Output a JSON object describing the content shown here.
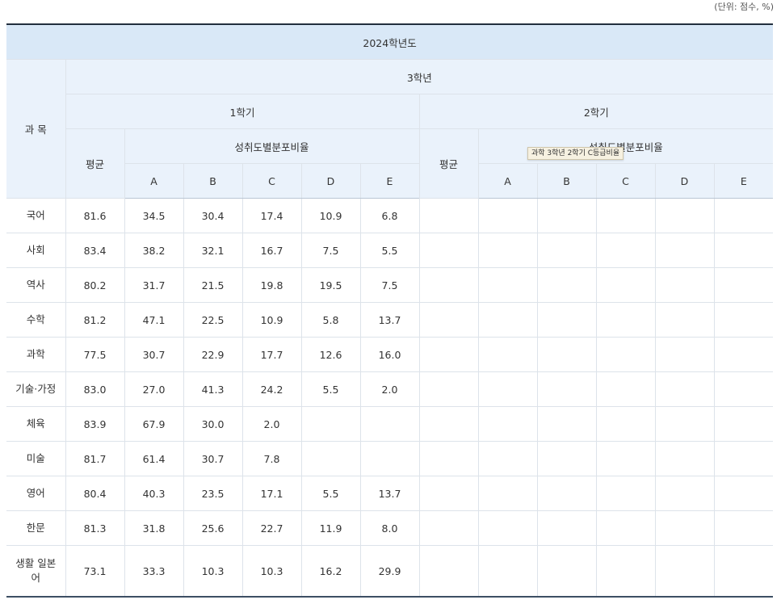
{
  "unit_note": "(단위: 점수, %)",
  "header": {
    "year": "2024학년도",
    "subject_col": "과 목",
    "grade": "3학년",
    "semester1": "1학기",
    "semester2": "2학기",
    "average": "평균",
    "distribution": "성취도별분포비율",
    "letters": [
      "A",
      "B",
      "C",
      "D",
      "E"
    ]
  },
  "tooltip": "과학 3학년 2학기 C등급비율",
  "rows": [
    {
      "subject": "국어",
      "s1": [
        "81.6",
        "34.5",
        "30.4",
        "17.4",
        "10.9",
        "6.8"
      ]
    },
    {
      "subject": "사회",
      "s1": [
        "83.4",
        "38.2",
        "32.1",
        "16.7",
        "7.5",
        "5.5"
      ]
    },
    {
      "subject": "역사",
      "s1": [
        "80.2",
        "31.7",
        "21.5",
        "19.8",
        "19.5",
        "7.5"
      ]
    },
    {
      "subject": "수학",
      "s1": [
        "81.2",
        "47.1",
        "22.5",
        "10.9",
        "5.8",
        "13.7"
      ]
    },
    {
      "subject": "과학",
      "s1": [
        "77.5",
        "30.7",
        "22.9",
        "17.7",
        "12.6",
        "16.0"
      ]
    },
    {
      "subject": "기술·가정",
      "s1": [
        "83.0",
        "27.0",
        "41.3",
        "24.2",
        "5.5",
        "2.0"
      ]
    },
    {
      "subject": "체육",
      "s1": [
        "83.9",
        "67.9",
        "30.0",
        "2.0",
        "",
        ""
      ]
    },
    {
      "subject": "미술",
      "s1": [
        "81.7",
        "61.4",
        "30.7",
        "7.8",
        "",
        ""
      ]
    },
    {
      "subject": "영어",
      "s1": [
        "80.4",
        "40.3",
        "23.5",
        "17.1",
        "5.5",
        "13.7"
      ]
    },
    {
      "subject": "한문",
      "s1": [
        "81.3",
        "31.8",
        "25.6",
        "22.7",
        "11.9",
        "8.0"
      ]
    },
    {
      "subject": "생활 일본어",
      "s1": [
        "73.1",
        "33.3",
        "10.3",
        "10.3",
        "16.2",
        "29.9"
      ]
    }
  ]
}
